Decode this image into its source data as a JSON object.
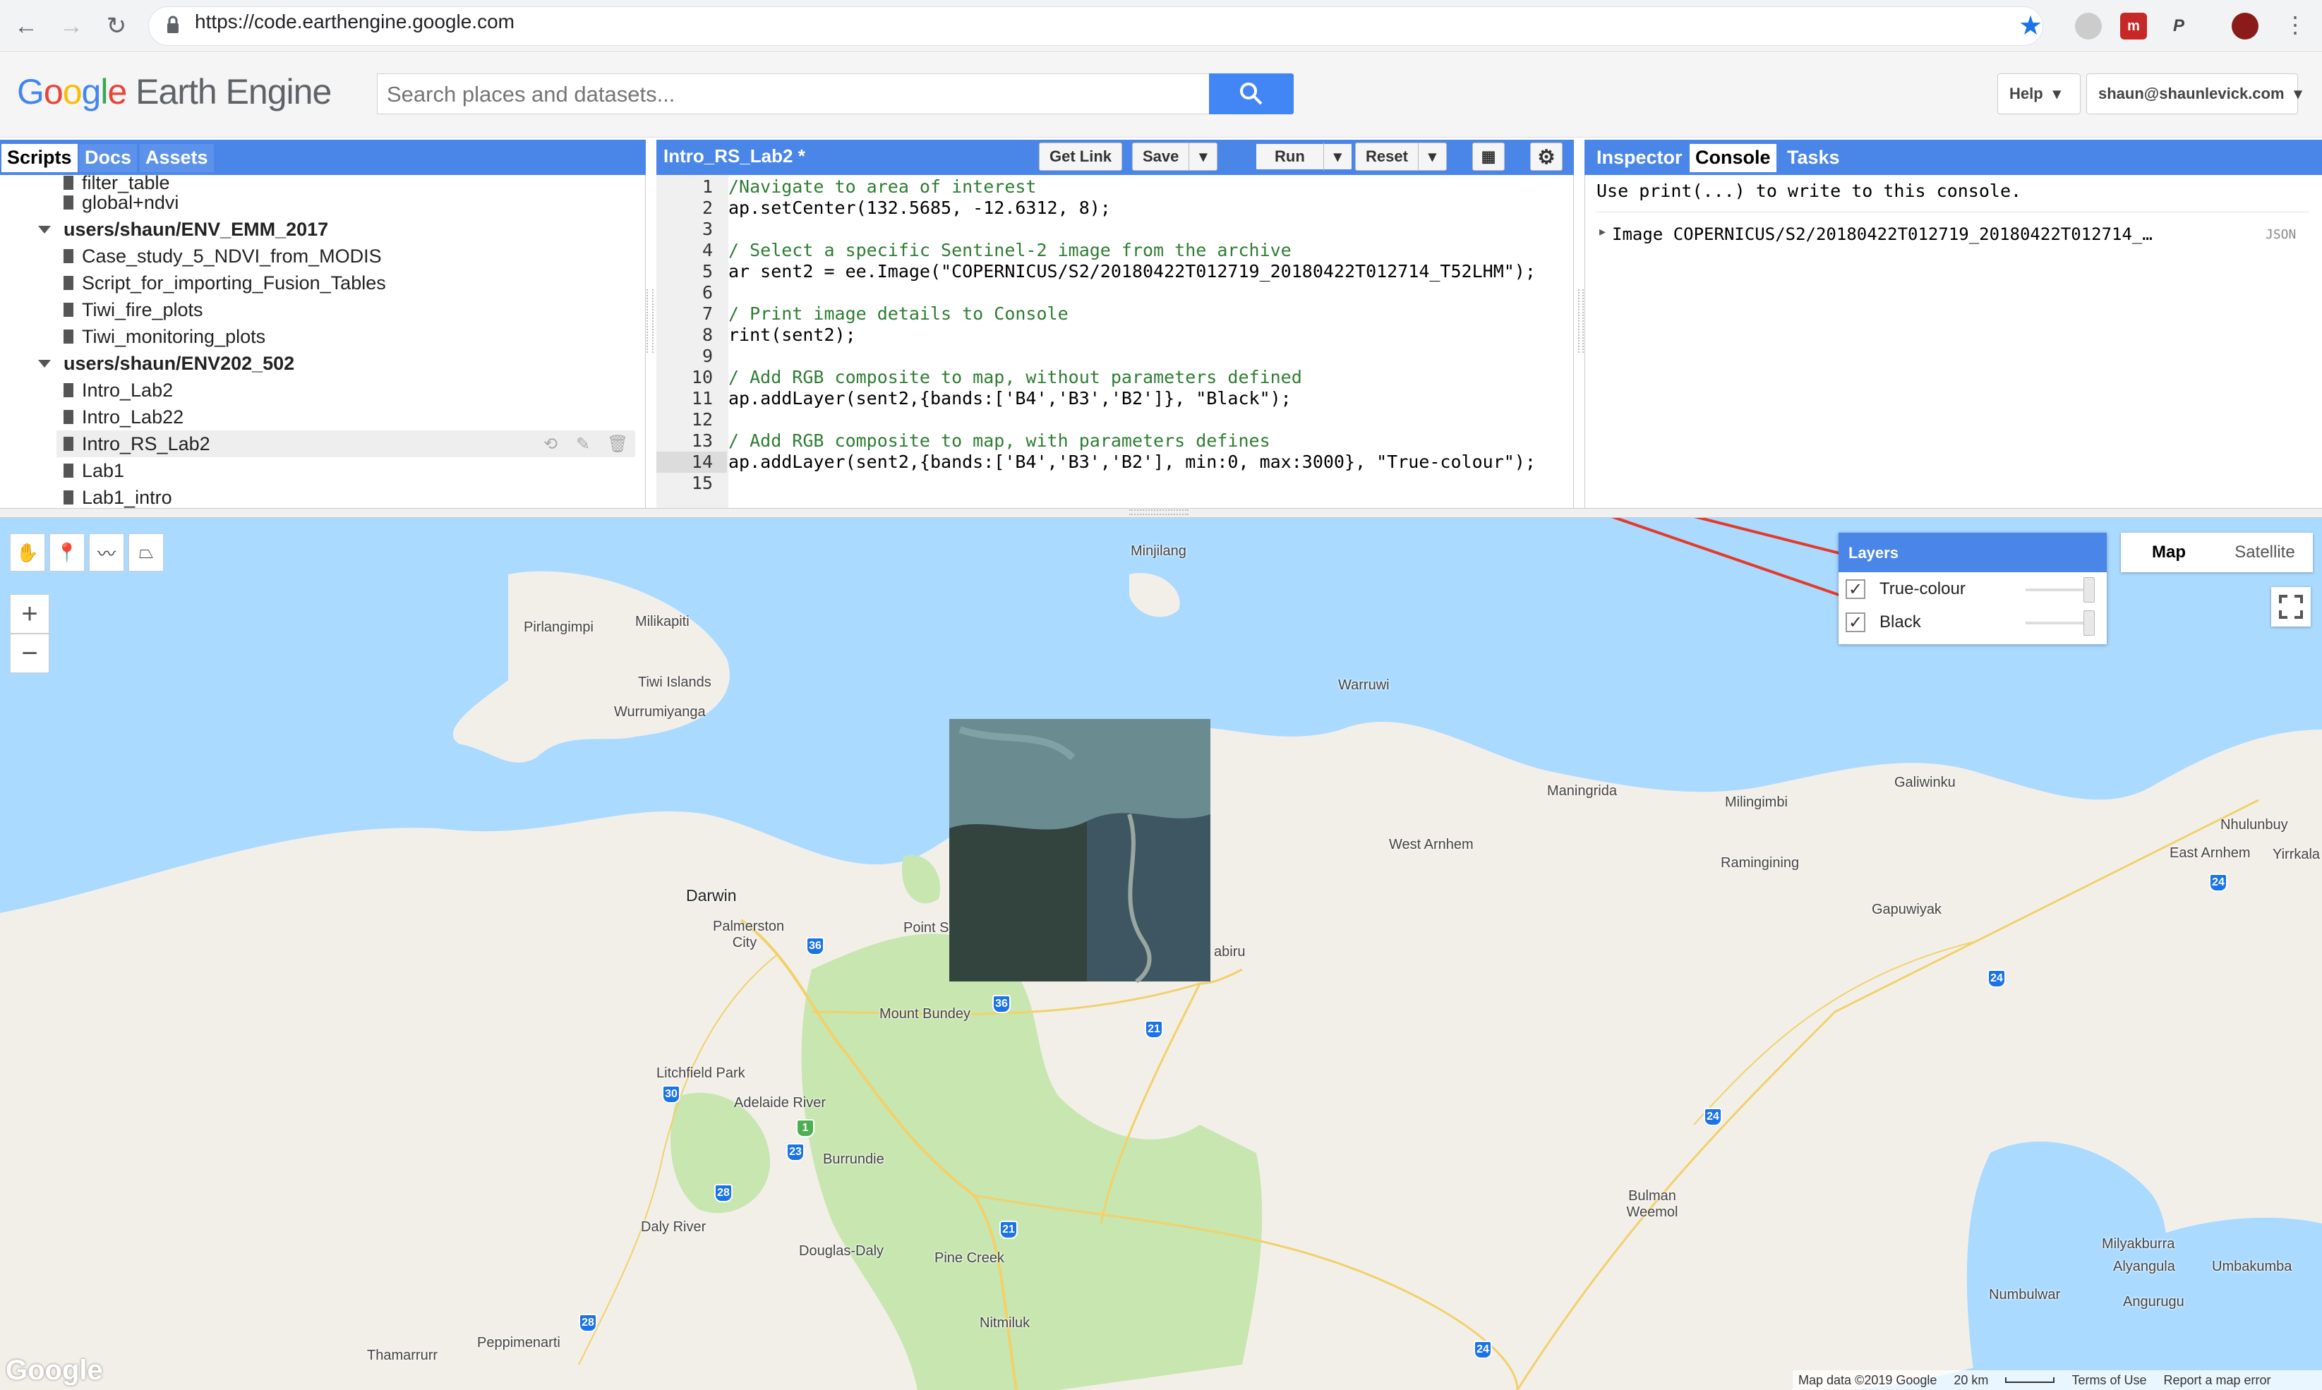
{
  "browser": {
    "url": "https://code.earthengine.google.com"
  },
  "header": {
    "logo_google": "Google",
    "logo_product": "Earth Engine",
    "search_placeholder": "Search places and datasets...",
    "help_label": "Help",
    "account_label": "shaun@shaunlevick.com"
  },
  "left_panel": {
    "tabs": [
      "Scripts",
      "Docs",
      "Assets"
    ],
    "tree": [
      {
        "label": "filter_table",
        "type": "file"
      },
      {
        "label": "global+ndvi",
        "type": "file"
      },
      {
        "label": "users/shaun/ENV_EMM_2017",
        "type": "folder"
      },
      {
        "label": "Case_study_5_NDVI_from_MODIS",
        "type": "file"
      },
      {
        "label": "Script_for_importing_Fusion_Tables",
        "type": "file"
      },
      {
        "label": "Tiwi_fire_plots",
        "type": "file"
      },
      {
        "label": "Tiwi_monitoring_plots",
        "type": "file"
      },
      {
        "label": "users/shaun/ENV202_502",
        "type": "folder"
      },
      {
        "label": "Intro_Lab2",
        "type": "file"
      },
      {
        "label": "Intro_Lab22",
        "type": "file"
      },
      {
        "label": "Intro_RS_Lab2",
        "type": "file"
      },
      {
        "label": "Lab1",
        "type": "file"
      },
      {
        "label": "Lab1_intro",
        "type": "file"
      }
    ]
  },
  "editor": {
    "title": "Intro_RS_Lab2 *",
    "buttons": {
      "get_link": "Get Link",
      "save": "Save",
      "run": "Run",
      "reset": "Reset"
    },
    "line_numbers": [
      "1",
      "2",
      "3",
      "4",
      "5",
      "6",
      "7",
      "8",
      "9",
      "10",
      "11",
      "12",
      "13",
      "14",
      "15"
    ],
    "lines": [
      "/Navigate to area of interest",
      "ap.setCenter(132.5685, -12.6312, 8);",
      "",
      "/ Select a specific Sentinel-2 image from the archive",
      "ar sent2 = ee.Image(\"COPERNICUS/S2/20180422T012719_20180422T012714_T52LHM\");",
      "",
      "/ Print image details to Console",
      "rint(sent2);",
      "",
      "/ Add RGB composite to map, without parameters defined",
      "ap.addLayer(sent2,{bands:['B4','B3','B2']}, \"Black\");",
      "",
      "/ Add RGB composite to map, with parameters defines",
      "ap.addLayer(sent2,{bands:['B4','B3','B2'], min:0, max:3000}, \"True-colour\");",
      ""
    ]
  },
  "right_panel": {
    "tabs": [
      "Inspector",
      "Console",
      "Tasks"
    ],
    "console_hint": "Use print(...) to write to this console.",
    "console_entry": "Image COPERNICUS/S2/20180422T012719_20180422T012714_…",
    "console_entry_tag": "JSON"
  },
  "map": {
    "layers_title": "Layers",
    "layers": [
      {
        "name": "True-colour",
        "checked": true
      },
      {
        "name": "Black",
        "checked": true
      }
    ],
    "map_type": [
      "Map",
      "Satellite"
    ],
    "labels": [
      "Minjilang",
      "Pirlangimpi",
      "Milikapiti",
      "Tiwi Islands",
      "Wurrumiyanga",
      "Warruwi",
      "Maningrida",
      "Galiwinku",
      "Milingimbi",
      "Nhulunbuy",
      "Yirrkala",
      "East Arnhem",
      "West Arnhem",
      "Ramingining",
      "Gapuwiyak",
      "Darwin",
      "Palmerston City",
      "Point S",
      "abiru",
      "Mount Bundey",
      "Litchfield Park",
      "Adelaide River",
      "Burrundie",
      "Daly River",
      "Douglas-Daly",
      "Pine Creek",
      "Nitmiluk",
      "Peppimenarti",
      "Thamarrurr",
      "Bulman Weemol",
      "Milyakburra",
      "Alyangula",
      "Umbakumba",
      "Numbulwar",
      "Angurugu"
    ],
    "road_shields": [
      "36",
      "36",
      "21",
      "30",
      "1",
      "23",
      "28",
      "21",
      "28",
      "24",
      "24",
      "24",
      "24"
    ],
    "attribution": {
      "data": "Map data ©2019 Google",
      "scale": "20 km",
      "terms": "Terms of Use",
      "report": "Report a map error"
    },
    "google_mark": "Google"
  },
  "colors": {
    "accent": "#4a86e8",
    "water": "#aadaff",
    "land": "#f2efe9",
    "park": "#c8e6b0",
    "arrow": "#e53a2a"
  }
}
